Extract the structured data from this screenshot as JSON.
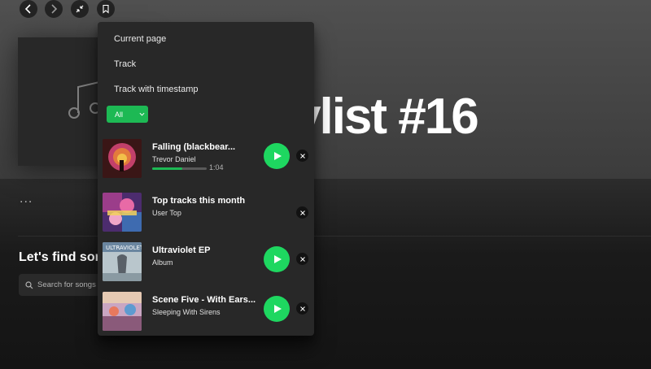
{
  "background": {
    "playlist_title": "ylist #16",
    "find_heading": "Let's find some",
    "search_placeholder": "Search for songs o",
    "more_label": "..."
  },
  "menu": {
    "items": [
      {
        "label": "Current page"
      },
      {
        "label": "Track"
      },
      {
        "label": "Track with timestamp"
      }
    ],
    "filter": {
      "selected": "All"
    },
    "entries": [
      {
        "title": "Falling (blackbear...",
        "subtitle": "Trevor Daniel",
        "progress": 0.55,
        "time": "1:04",
        "has_play": true
      },
      {
        "title": "Top tracks this month",
        "subtitle": "User Top",
        "has_play": false
      },
      {
        "title": "Ultraviolet EP",
        "subtitle": "Album",
        "has_play": true
      },
      {
        "title": "Scene Five - With Ears...",
        "subtitle": "Sleeping With Sirens",
        "has_play": true
      }
    ]
  },
  "colors": {
    "accent": "#1db954",
    "menu_bg": "#282828",
    "page_bg": "#121212"
  },
  "icons": [
    "chevron-left-icon",
    "chevron-right-icon",
    "collapse-icon",
    "bookmark-icon",
    "music-note-icon",
    "search-icon",
    "chevron-down-icon",
    "play-icon",
    "close-icon"
  ]
}
